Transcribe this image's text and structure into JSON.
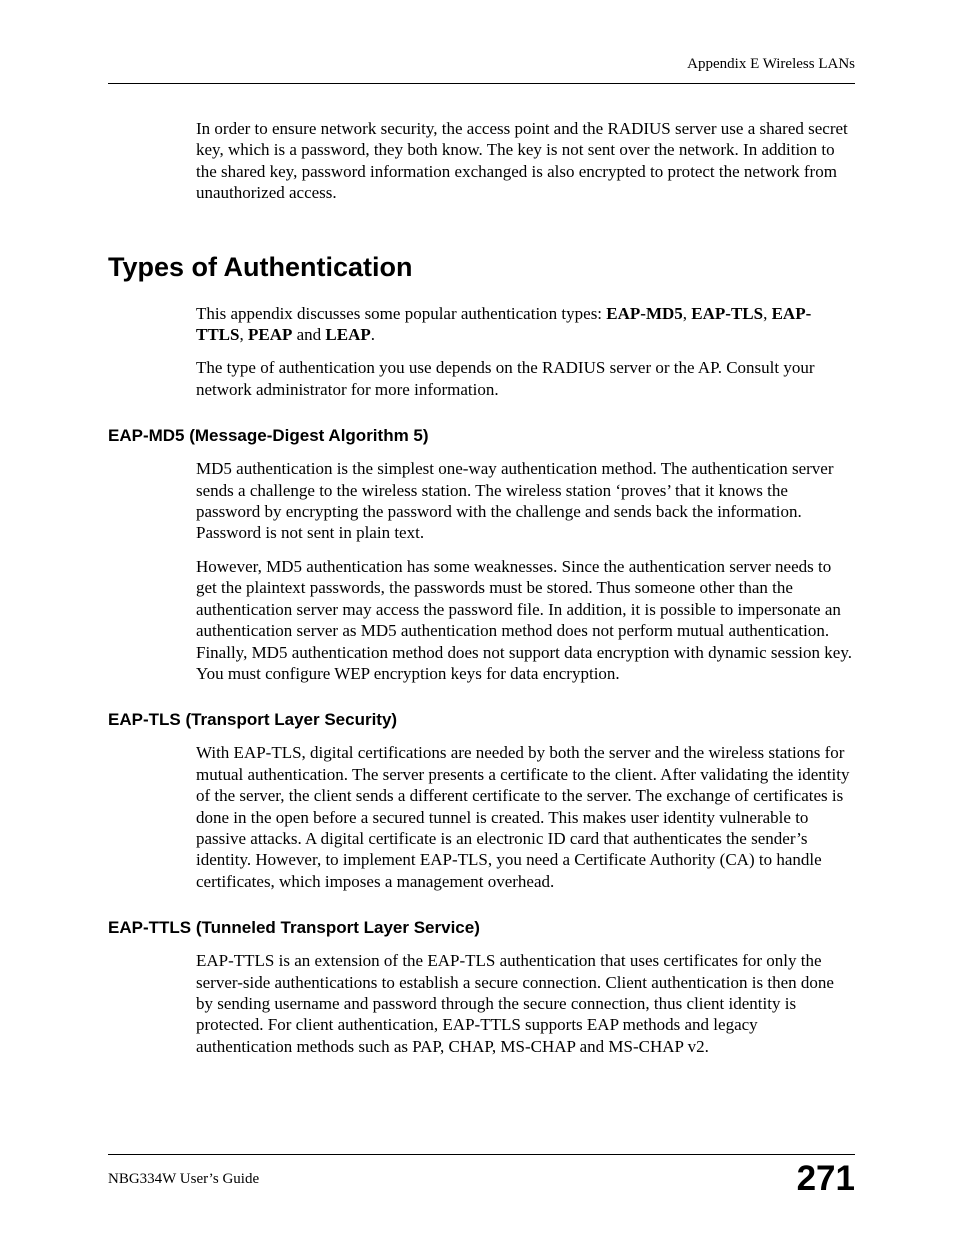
{
  "header": {
    "label": "Appendix E Wireless LANs"
  },
  "intro": {
    "para1": "In order to ensure network security, the access point and the RADIUS server use a shared secret key, which is a password, they both know. The key is not sent over the network. In addition to the shared key, password information exchanged is also encrypted to protect the network from unauthorized access."
  },
  "section": {
    "title": "Types of Authentication",
    "para1_pre": "This appendix discusses some popular authentication types: ",
    "b1": "EAP-MD5",
    "sep1": ", ",
    "b2": "EAP-TLS",
    "sep2": ", ",
    "b3": "EAP-TTLS",
    "sep3": ", ",
    "b4": "PEAP",
    "sep4": " and ",
    "b5": "LEAP",
    "sep5": ".",
    "para2": "The type of authentication you use depends on the RADIUS server or the AP. Consult your network administrator for more information."
  },
  "sub1": {
    "title": "EAP-MD5 (Message-Digest Algorithm 5)",
    "para1": "MD5 authentication is the simplest one-way authentication method. The authentication server sends a challenge to the wireless station. The wireless station ‘proves’ that it knows the password by encrypting the password with the challenge and sends back the information. Password is not sent in plain text.",
    "para2": "However, MD5 authentication has some weaknesses. Since the authentication server needs to get the plaintext passwords, the passwords must be stored. Thus someone other than the authentication server may access the password file. In addition, it is possible to impersonate an authentication server as MD5 authentication method does not perform mutual authentication. Finally, MD5 authentication method does not support data encryption with dynamic session key. You must configure WEP encryption keys for data encryption."
  },
  "sub2": {
    "title": "EAP-TLS (Transport Layer Security)",
    "para1": "With EAP-TLS, digital certifications are needed by both the server and the wireless stations for mutual authentication. The server presents a certificate to the client. After validating the identity of the server, the client sends a different certificate to the server. The exchange of certificates is done in the open before a secured tunnel is created. This makes user identity vulnerable to passive attacks. A digital certificate is an electronic ID card that authenticates the sender’s identity. However, to implement EAP-TLS, you need a Certificate Authority (CA) to handle certificates, which imposes a management overhead."
  },
  "sub3": {
    "title": "EAP-TTLS (Tunneled Transport Layer Service)",
    "para1": "EAP-TTLS is an extension of the EAP-TLS authentication that uses certificates for only the server-side authentications to establish a secure connection. Client authentication is then done by sending username and password through the secure connection, thus client identity is protected. For client authentication, EAP-TTLS supports EAP methods and legacy authentication methods such as PAP, CHAP, MS-CHAP and MS-CHAP v2."
  },
  "footer": {
    "guide": "NBG334W User’s Guide",
    "page": "271"
  }
}
